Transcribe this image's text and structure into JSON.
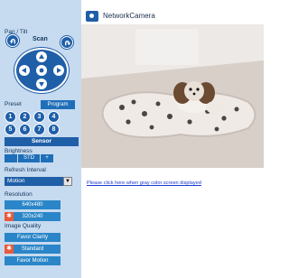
{
  "window": {
    "title": "NetworkCamera"
  },
  "pan_tilt": {
    "label": "Pan / Tilt",
    "scan_label": "Scan"
  },
  "preset": {
    "label": "Preset",
    "program_label": "Program",
    "buttons": [
      "1",
      "2",
      "3",
      "4",
      "5",
      "6",
      "7",
      "8"
    ],
    "sensor_label": "Sensor"
  },
  "brightness": {
    "label": "Brightness",
    "std_label": "STD",
    "plus_label": "+"
  },
  "refresh": {
    "label": "Refresh Interval",
    "value": "Motion"
  },
  "resolution": {
    "label": "Resolution",
    "options": [
      "640x480",
      "320x240"
    ]
  },
  "quality": {
    "label": "Image Quality",
    "options": [
      "Favor Clarity",
      "Standard",
      "Favor Motion"
    ]
  },
  "link_text": "Please click here when gray color screen displayed",
  "colors": {
    "panel": "#c6daf0",
    "accent": "#1f5fa8",
    "selected_marker": "#e85a3a"
  }
}
